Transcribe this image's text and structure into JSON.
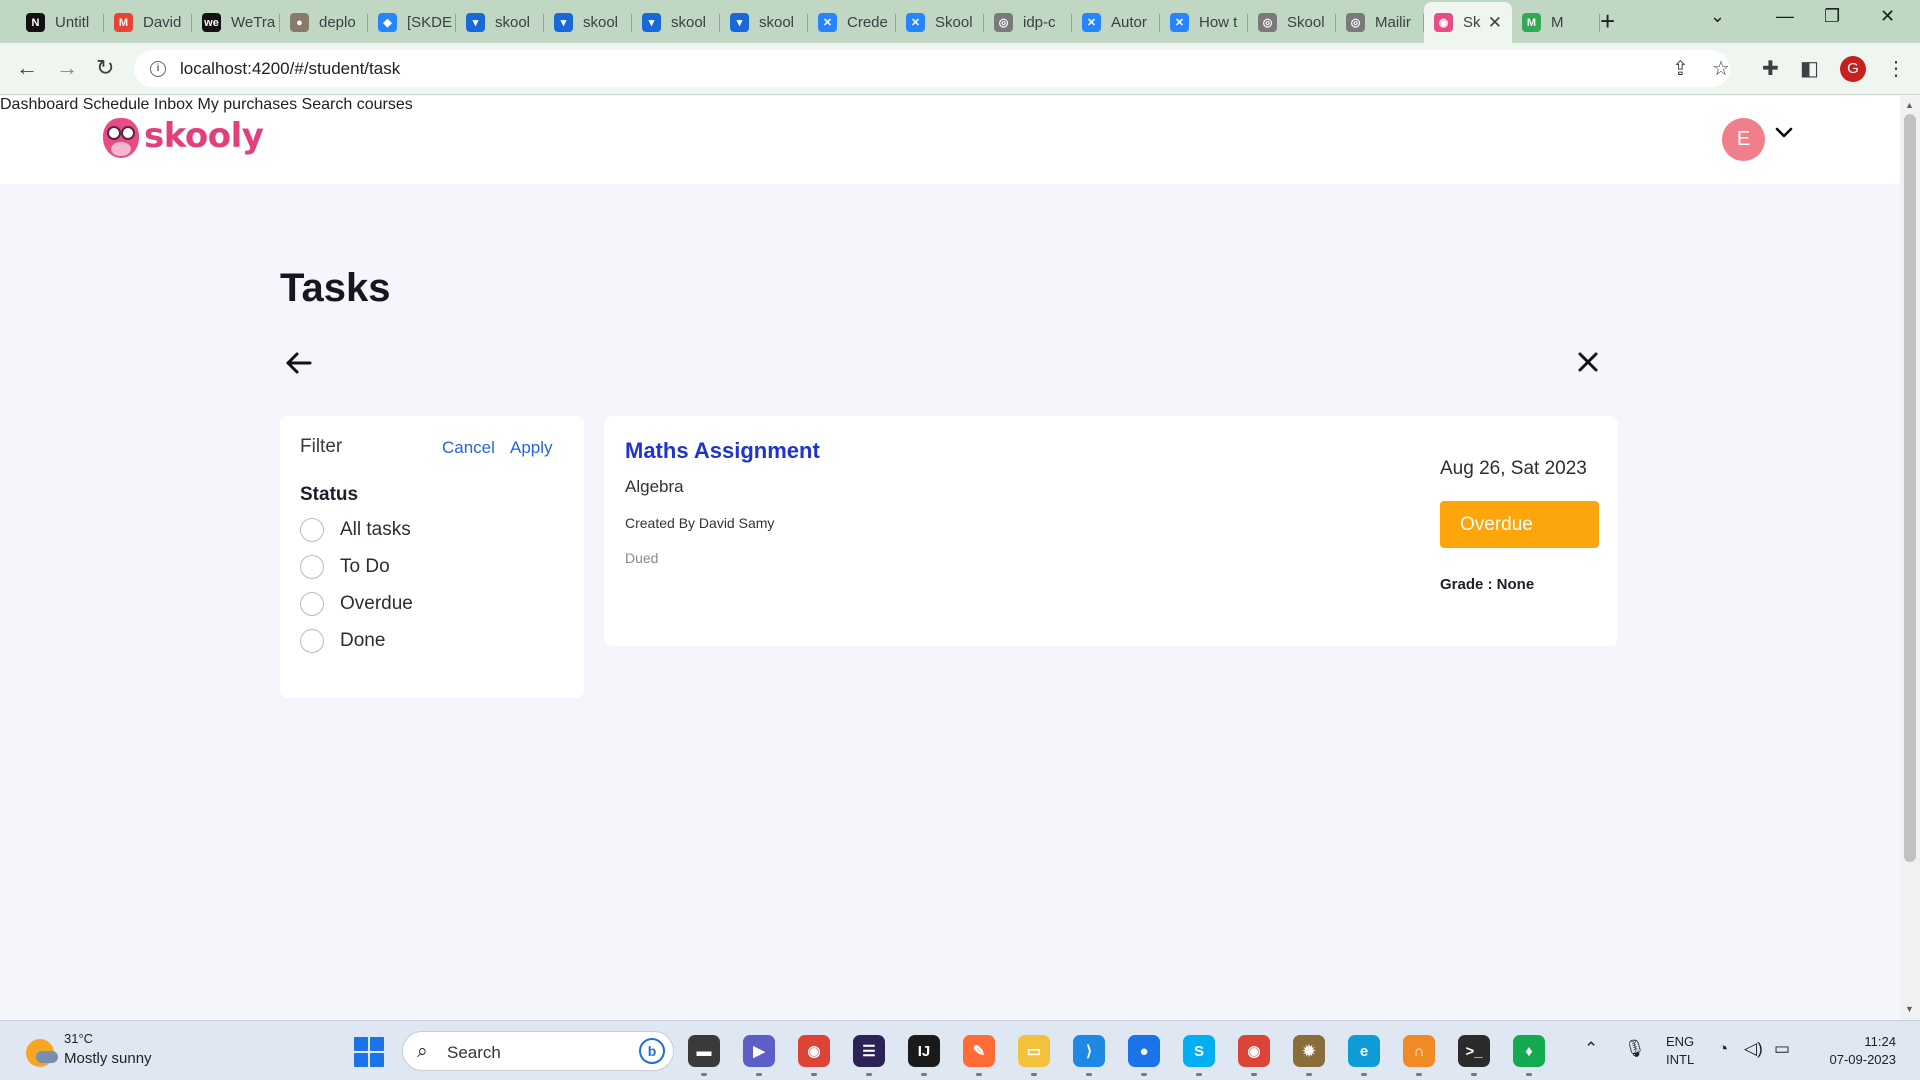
{
  "browser": {
    "tabs": [
      {
        "title": "Untitl",
        "fav_color": "#111111",
        "fav_glyph": "N"
      },
      {
        "title": "David",
        "fav_color": "#ea4335",
        "fav_glyph": "M"
      },
      {
        "title": "WeTra",
        "fav_color": "#111111",
        "fav_glyph": "we"
      },
      {
        "title": "deplo",
        "fav_color": "#8a7a6a",
        "fav_glyph": "●"
      },
      {
        "title": "[SKDE",
        "fav_color": "#2684ff",
        "fav_glyph": "◆"
      },
      {
        "title": "skool",
        "fav_color": "#1868db",
        "fav_glyph": "▾"
      },
      {
        "title": "skool",
        "fav_color": "#1868db",
        "fav_glyph": "▾"
      },
      {
        "title": "skool",
        "fav_color": "#1868db",
        "fav_glyph": "▾"
      },
      {
        "title": "skool",
        "fav_color": "#1868db",
        "fav_glyph": "▾"
      },
      {
        "title": "Crede",
        "fav_color": "#2684ff",
        "fav_glyph": "✕"
      },
      {
        "title": "Skool",
        "fav_color": "#2684ff",
        "fav_glyph": "✕"
      },
      {
        "title": "idp-c",
        "fav_color": "#7a7a7a",
        "fav_glyph": "◎"
      },
      {
        "title": "Autor",
        "fav_color": "#2684ff",
        "fav_glyph": "✕"
      },
      {
        "title": "How t",
        "fav_color": "#2684ff",
        "fav_glyph": "✕"
      },
      {
        "title": "Skool",
        "fav_color": "#7a7a7a",
        "fav_glyph": "◎"
      },
      {
        "title": "Mailir",
        "fav_color": "#7a7a7a",
        "fav_glyph": "◎"
      },
      {
        "title": "Sk",
        "fav_color": "#e94b86",
        "fav_glyph": "◉",
        "active": true
      },
      {
        "title": "M",
        "fav_color": "#34a853",
        "fav_glyph": "M"
      }
    ],
    "url": "localhost:4200/#/student/task",
    "profile_initial": "G"
  },
  "app": {
    "brand": "skooly",
    "nav": [
      "Dashboard",
      "Schedule",
      "Inbox",
      "My purchases",
      "Search courses"
    ],
    "avatar_initial": "E"
  },
  "page": {
    "title": "Tasks"
  },
  "filter": {
    "title": "Filter",
    "cancel_label": "Cancel",
    "apply_label": "Apply",
    "status_label": "Status",
    "options": [
      "All tasks",
      "To Do",
      "Overdue",
      "Done"
    ]
  },
  "task": {
    "title": "Maths Assignment",
    "subject": "Algebra",
    "creator": "Created By David Samy",
    "due_text": "Dued",
    "date": "Aug 26, Sat 2023",
    "status": "Overdue",
    "status_color": "#fca60b",
    "grade": "Grade : None"
  },
  "taskbar": {
    "temperature": "31°C",
    "weather": "Mostly sunny",
    "search_placeholder": "Search",
    "lang_1": "ENG",
    "lang_2": "INTL",
    "time": "11:24",
    "date": "07-09-2023",
    "apps": [
      {
        "name": "file-manager-icon",
        "color": "#3a3a3a",
        "glyph": "▬"
      },
      {
        "name": "teams-icon",
        "color": "#5b5fc7",
        "glyph": "▶"
      },
      {
        "name": "chrome-icon",
        "color": "#db4437",
        "glyph": "◉"
      },
      {
        "name": "eclipse-icon",
        "color": "#2c2255",
        "glyph": "☰"
      },
      {
        "name": "intellij-icon",
        "color": "#1a1a1a",
        "glyph": "IJ"
      },
      {
        "name": "postman-icon",
        "color": "#ff6c37",
        "glyph": "✎"
      },
      {
        "name": "explorer-icon",
        "color": "#f3c13a",
        "glyph": "▭"
      },
      {
        "name": "vscode-icon",
        "color": "#1e88e5",
        "glyph": "⟩"
      },
      {
        "name": "maps-icon",
        "color": "#1a73e8",
        "glyph": "●"
      },
      {
        "name": "skype-icon",
        "color": "#00aff0",
        "glyph": "S"
      },
      {
        "name": "chrome-profile-icon",
        "color": "#db4437",
        "glyph": "◉"
      },
      {
        "name": "tools-icon",
        "color": "#8a6d3b",
        "glyph": "✹"
      },
      {
        "name": "edge-icon",
        "color": "#0f9bd7",
        "glyph": "e"
      },
      {
        "name": "app-icon",
        "color": "#f08a24",
        "glyph": "∩"
      },
      {
        "name": "terminal-icon",
        "color": "#2b2b2b",
        "glyph": ">_"
      },
      {
        "name": "mongodb-icon",
        "color": "#13aa52",
        "glyph": "♦"
      }
    ]
  }
}
